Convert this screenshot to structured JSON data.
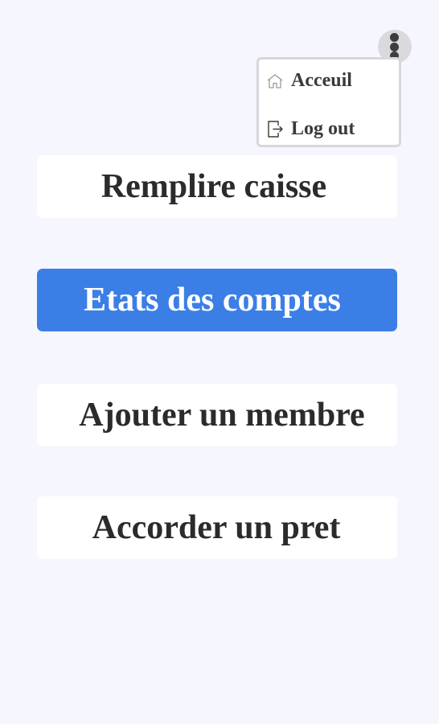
{
  "menu": {
    "items": [
      {
        "label": "Acceuil",
        "icon": "home-icon"
      },
      {
        "label": "Log out",
        "icon": "logout-icon"
      }
    ]
  },
  "actions": [
    {
      "label": "Remplire caisse"
    },
    {
      "label": "Etats des comptes"
    },
    {
      "label": "Ajouter un membre"
    },
    {
      "label": "Accorder un pret"
    }
  ],
  "colors": {
    "background": "#f5f6fe",
    "primary": "#3b7fe6",
    "button": "#ffffff",
    "text": "#2b2b2b",
    "more_button": "#d9d9de"
  }
}
